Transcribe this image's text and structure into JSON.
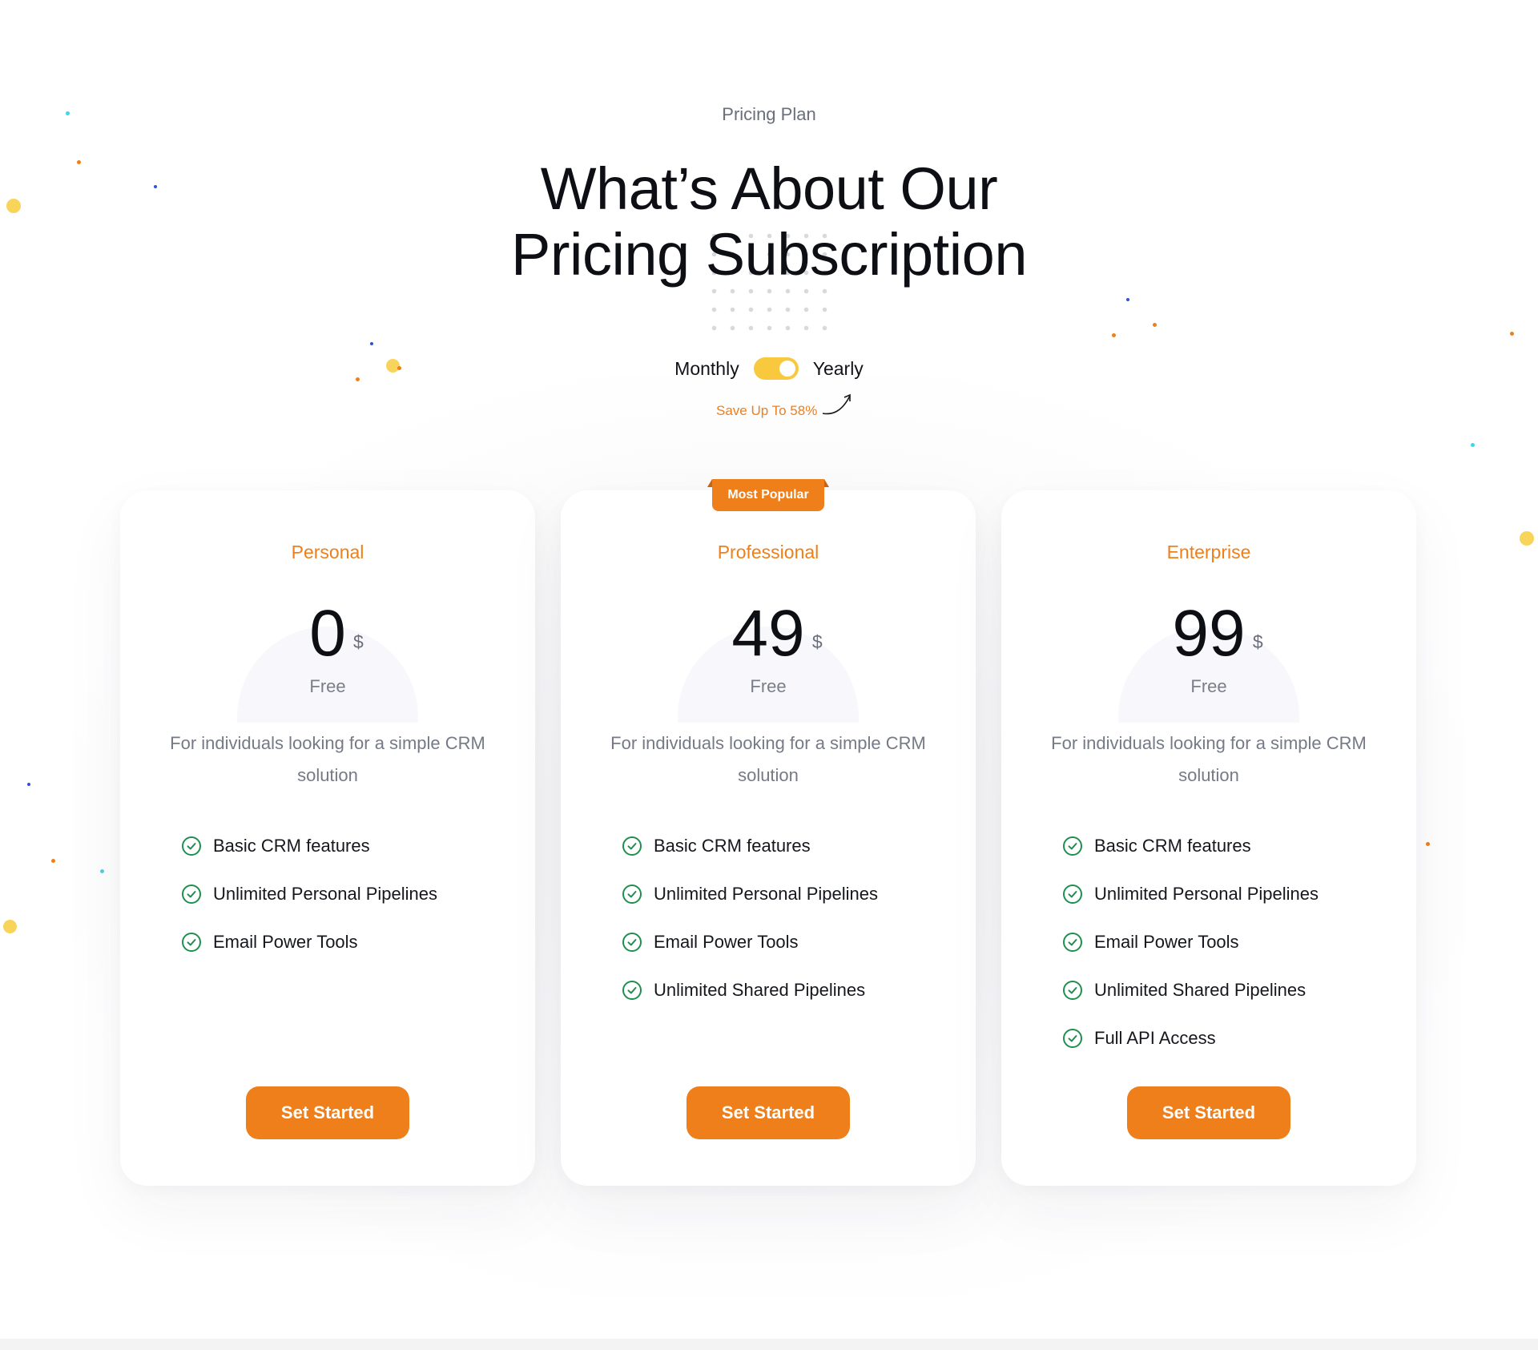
{
  "header": {
    "eyebrow": "Pricing Plan",
    "title_line1": "What’s About Our",
    "title_line2": "Pricing Subscription"
  },
  "billing_toggle": {
    "left_label": "Monthly",
    "right_label": "Yearly",
    "selected": "Yearly",
    "save_note": "Save Up To 58%"
  },
  "colors": {
    "accent": "#ee7f1a",
    "toggle": "#f8c93f",
    "check": "#1e8f4e"
  },
  "plans": [
    {
      "name": "Personal",
      "price": "0",
      "currency": "$",
      "period": "Free",
      "description": "For individuals looking for a simple CRM solution",
      "features": [
        "Basic CRM features",
        "Unlimited Personal Pipelines",
        "Email Power Tools"
      ],
      "cta": "Set Started"
    },
    {
      "name": "Professional",
      "badge": "Most Popular",
      "price": "49",
      "currency": "$",
      "period": "Free",
      "description": "For individuals looking for a simple CRM solution",
      "features": [
        "Basic CRM features",
        "Unlimited Personal Pipelines",
        "Email Power Tools",
        "Unlimited Shared Pipelines"
      ],
      "cta": "Set Started"
    },
    {
      "name": "Enterprise",
      "price": "99",
      "currency": "$",
      "period": "Free",
      "description": "For individuals looking for a simple CRM solution",
      "features": [
        "Basic CRM features",
        "Unlimited Personal Pipelines",
        "Email Power Tools",
        "Unlimited Shared Pipelines",
        "Full API Access"
      ],
      "cta": "Set Started"
    }
  ]
}
